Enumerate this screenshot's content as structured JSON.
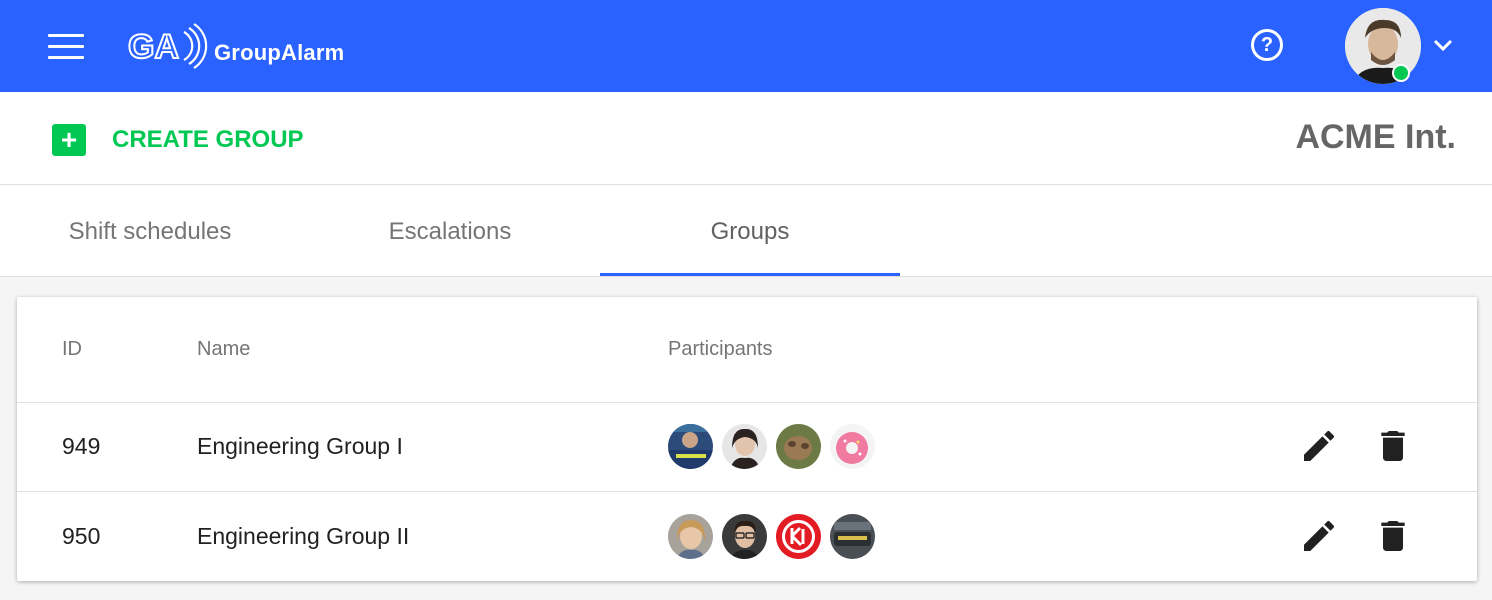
{
  "header": {
    "brand": "GroupAlarm",
    "logo_mark": "GA",
    "icons": {
      "menu": "menu-icon",
      "help": "help-icon",
      "chevron": "chevron-down-icon"
    },
    "help_glyph": "?",
    "colors": {
      "bar": "#2962ff",
      "presence": "#00c853"
    }
  },
  "actions": {
    "create_icon": "+",
    "create_label": "CREATE GROUP",
    "organization": "ACME Int."
  },
  "tabs": [
    {
      "label": "Shift schedules",
      "active": false
    },
    {
      "label": "Escalations",
      "active": false
    },
    {
      "label": "Groups",
      "active": true
    }
  ],
  "table": {
    "columns": [
      "ID",
      "Name",
      "Participants"
    ],
    "rows": [
      {
        "id": "949",
        "name": "Engineering Group I",
        "participants": [
          "participant-photo",
          "participant-photo",
          "participant-photo",
          "participant-photo"
        ]
      },
      {
        "id": "950",
        "name": "Engineering Group II",
        "participants": [
          "participant-photo",
          "participant-photo",
          "participant-photo",
          "participant-photo"
        ]
      }
    ],
    "row_actions": [
      "edit-icon",
      "delete-icon"
    ]
  },
  "accent_color": "#00c853"
}
